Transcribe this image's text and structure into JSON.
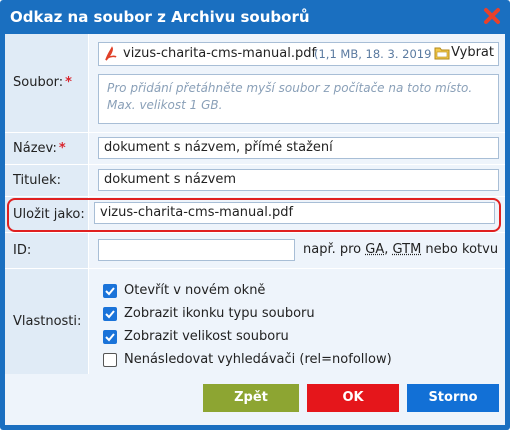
{
  "dialog": {
    "title": "Odkaz na soubor z Archivu souborů"
  },
  "file": {
    "label": "Soubor:",
    "required_mark": "*",
    "filename": "vizus-charita-cms-manual.pdf",
    "meta": "(1,1 MB, 18. 3. 2019",
    "choose_label": "Vybrat",
    "dropzone_text": "Pro přidání přetáhněte myší soubor z počítače na toto místo. Max. velikost 1 GB."
  },
  "name": {
    "label": "Název:",
    "required_mark": "*",
    "value": "dokument s názvem, přímé stažení"
  },
  "caption": {
    "label": "Titulek:",
    "value": "dokument s názvem"
  },
  "save_as": {
    "label": "Uložit jako:",
    "value": "vizus-charita-cms-manual.pdf"
  },
  "id": {
    "label": "ID:",
    "value": "",
    "hint_prefix": "např. pro ",
    "hint_ga": "GA",
    "hint_sep": ", ",
    "hint_gtm": "GTM",
    "hint_suffix": " nebo kotvu"
  },
  "properties": {
    "label": "Vlastnosti:",
    "options": [
      {
        "label": "Otevřít v novém okně",
        "checked": true
      },
      {
        "label": "Zobrazit ikonku typu souboru",
        "checked": true
      },
      {
        "label": "Zobrazit velikost souboru",
        "checked": true
      },
      {
        "label": "Nenásledovat vyhledávači (rel=nofollow)",
        "checked": false
      }
    ]
  },
  "buttons": {
    "back": "Zpět",
    "ok": "OK",
    "cancel": "Storno"
  },
  "colors": {
    "titlebar": "#1a6fc0",
    "back": "#8da532",
    "ok": "#e5161b",
    "cancel": "#1270d6",
    "highlight": "#e02020"
  }
}
